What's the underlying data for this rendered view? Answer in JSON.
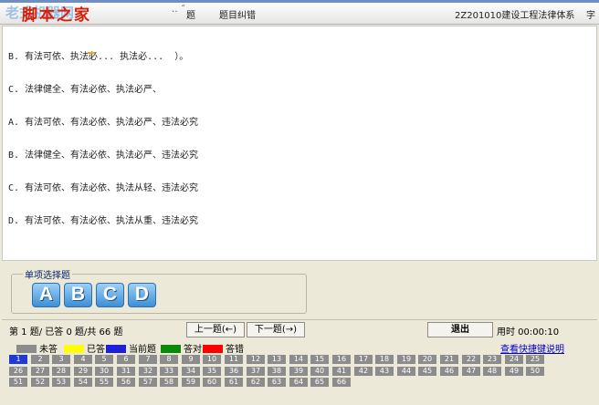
{
  "toolbar": {
    "watermark_text": "脚本之家",
    "watermark_ghost": "老式机器网",
    "dots": "‥ ˝",
    "item_1": "题",
    "item_2": "题目纠错",
    "item_3": "2Z201010建设工程法律体系",
    "item_4": "字"
  },
  "question": {
    "lines": [
      "B. 有法可依、执法必... 执法必...  ）。",
      "C. 法律健全、有法必依、执法必严、",
      "A. 有法可依、有法必依、执法必严、违法必究",
      "B. 法律健全、有法必依、执法必严、违法必究",
      "C. 有法可依、有法必依、执法从轻、违法必究",
      "D. 有法可依、有法必依、执法从重、违法必究"
    ]
  },
  "answer": {
    "group_label": "单项选择题",
    "options": [
      "A",
      "B",
      "C",
      "D"
    ]
  },
  "nav": {
    "progress": "第 1 题/ 已答 0 题/共 66 题",
    "prev_label": "上一题(←)",
    "next_label": "下一题(→)",
    "exit_label": "退出",
    "timer": "用时 00:00:10"
  },
  "legend": {
    "items": [
      {
        "label": "未答",
        "color": "#8c8c8c"
      },
      {
        "label": "已答",
        "color": "#ffff00"
      },
      {
        "label": "当前题",
        "color": "#1f1fd8"
      },
      {
        "label": "答对",
        "color": "#0a8a0a"
      },
      {
        "label": "答错",
        "color": "#ff0000"
      }
    ],
    "help_link": "查看快捷键说明"
  },
  "grid": {
    "current": 1,
    "total": 66
  }
}
